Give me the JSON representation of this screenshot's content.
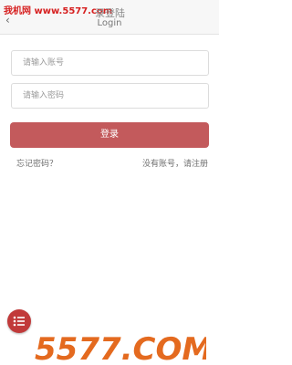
{
  "header": {
    "watermark": "我机网 www.5577.com",
    "title_cn": "录登陆",
    "title_en": "Login"
  },
  "form": {
    "account_placeholder": "请输入账号",
    "password_placeholder": "请输入密码",
    "login_label": "登录"
  },
  "links": {
    "forgot": "忘记密码？",
    "register": "没有账号，请注册"
  },
  "bottom_watermark": {
    "text": "5577.COM",
    "color": "#e46a1f"
  },
  "colors": {
    "accent": "#c35a5c",
    "fab": "#c13a3a"
  }
}
